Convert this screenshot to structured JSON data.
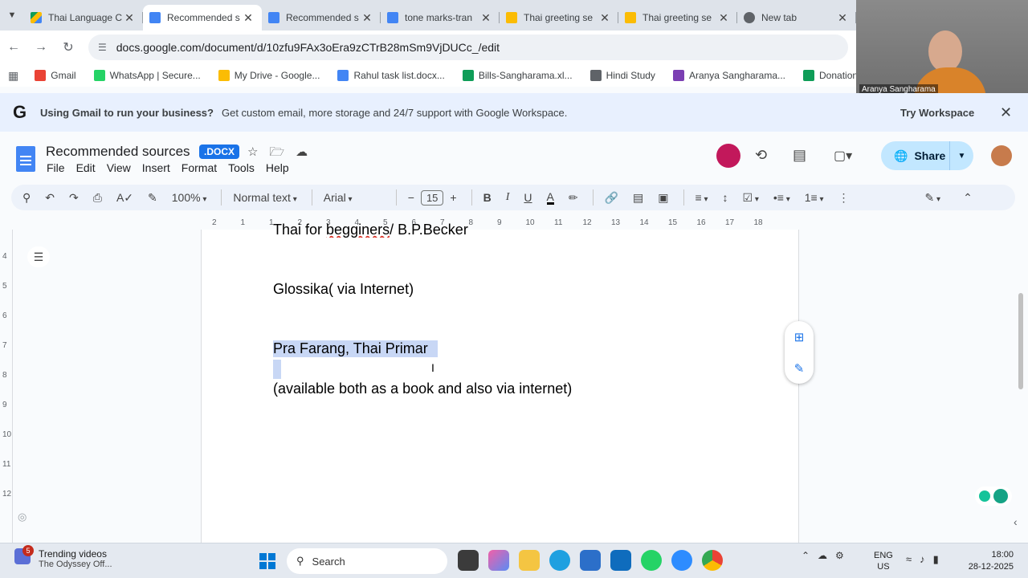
{
  "browser": {
    "tabs": [
      {
        "title": "Thai Language C",
        "icon": "drive-icon"
      },
      {
        "title": "Recommended s",
        "icon": "docs-icon",
        "active": true
      },
      {
        "title": "Recommended s",
        "icon": "docs-icon"
      },
      {
        "title": "tone marks-tran",
        "icon": "docs-icon"
      },
      {
        "title": "Thai greeting se",
        "icon": "slides-icon"
      },
      {
        "title": "Thai greeting se",
        "icon": "slides-icon"
      },
      {
        "title": "New tab",
        "icon": "chrome-icon"
      }
    ],
    "url": "docs.google.com/document/d/10zfu9FAx3oEra9zCTrB28mSm9VjDUCc_/edit",
    "bookmarks": [
      {
        "label": "Gmail",
        "color": "#ea4335"
      },
      {
        "label": "WhatsApp | Secure...",
        "color": "#25d366"
      },
      {
        "label": "My Drive - Google...",
        "color": "#fbbc04"
      },
      {
        "label": "Rahul task list.docx...",
        "color": "#4285f4"
      },
      {
        "label": "Bills-Sangharama.xl...",
        "color": "#0f9d58"
      },
      {
        "label": "Hindi Study",
        "color": "#5f6368"
      },
      {
        "label": "Aranya Sangharama...",
        "color": "#7b3fb3"
      },
      {
        "label": "Donation-Sangharа...",
        "color": "#0f9d58"
      }
    ]
  },
  "video": {
    "name": "Aranya Sangharama"
  },
  "banner": {
    "bold": "Using Gmail to run your business?",
    "text": "Get custom email, more storage and 24/7 support with Google Workspace.",
    "cta": "Try Workspace"
  },
  "doc": {
    "title": "Recommended sources",
    "badge": ".DOCX",
    "menu": [
      "File",
      "Edit",
      "View",
      "Insert",
      "Format",
      "Tools",
      "Help"
    ],
    "share": "Share"
  },
  "toolbar": {
    "zoom": "100%",
    "style": "Normal text",
    "font": "Arial",
    "size": "15"
  },
  "ruler": [
    "2",
    "1",
    "1",
    "2",
    "3",
    "4",
    "5",
    "6",
    "7",
    "8",
    "9",
    "10",
    "11",
    "12",
    "13",
    "14",
    "15",
    "16",
    "17",
    "18"
  ],
  "vruler": [
    "4",
    "5",
    "6",
    "7",
    "8",
    "9",
    "10",
    "11",
    "12"
  ],
  "content": {
    "line1_a": "Thai for ",
    "line1_b": "begginers",
    "line1_c": "/ B.P.Becker",
    "line2": "Glossika( via Internet)",
    "line3": "Pra Farang, Thai Primar",
    "line4": "(available both as a book and also via internet)"
  },
  "taskbar": {
    "trend_title": "Trending videos",
    "trend_sub": "The Odyssey Off...",
    "badge": "5",
    "search": "Search",
    "lang1": "ENG",
    "lang2": "US",
    "time": "18:00",
    "date": "28-12-2025"
  }
}
